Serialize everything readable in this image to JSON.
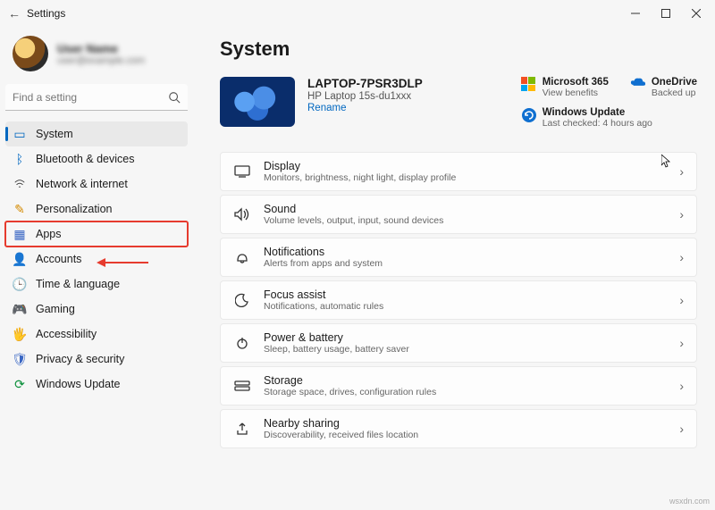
{
  "window": {
    "title": "Settings"
  },
  "user": {
    "name": "User Name",
    "email": "user@example.com"
  },
  "search": {
    "placeholder": "Find a setting"
  },
  "nav": {
    "system": {
      "label": "System"
    },
    "bluetooth": {
      "label": "Bluetooth & devices"
    },
    "network": {
      "label": "Network & internet"
    },
    "personal": {
      "label": "Personalization"
    },
    "apps": {
      "label": "Apps"
    },
    "accounts": {
      "label": "Accounts"
    },
    "time": {
      "label": "Time & language"
    },
    "gaming": {
      "label": "Gaming"
    },
    "accessibility": {
      "label": "Accessibility"
    },
    "privacy": {
      "label": "Privacy & security"
    },
    "update": {
      "label": "Windows Update"
    }
  },
  "main": {
    "heading": "System",
    "device": {
      "name": "LAPTOP-7PSR3DLP",
      "model": "HP Laptop 15s-du1xxx",
      "rename": "Rename"
    },
    "cards": {
      "m365": {
        "title": "Microsoft 365",
        "sub": "View benefits"
      },
      "onedrive": {
        "title": "OneDrive",
        "sub": "Backed up"
      },
      "update": {
        "title": "Windows Update",
        "sub": "Last checked: 4 hours ago"
      }
    },
    "items": {
      "display": {
        "title": "Display",
        "sub": "Monitors, brightness, night light, display profile"
      },
      "sound": {
        "title": "Sound",
        "sub": "Volume levels, output, input, sound devices"
      },
      "notif": {
        "title": "Notifications",
        "sub": "Alerts from apps and system"
      },
      "focus": {
        "title": "Focus assist",
        "sub": "Notifications, automatic rules"
      },
      "power": {
        "title": "Power & battery",
        "sub": "Sleep, battery usage, battery saver"
      },
      "storage": {
        "title": "Storage",
        "sub": "Storage space, drives, configuration rules"
      },
      "nearby": {
        "title": "Nearby sharing",
        "sub": "Discoverability, received files location"
      }
    }
  },
  "watermark": "wsxdn.com"
}
